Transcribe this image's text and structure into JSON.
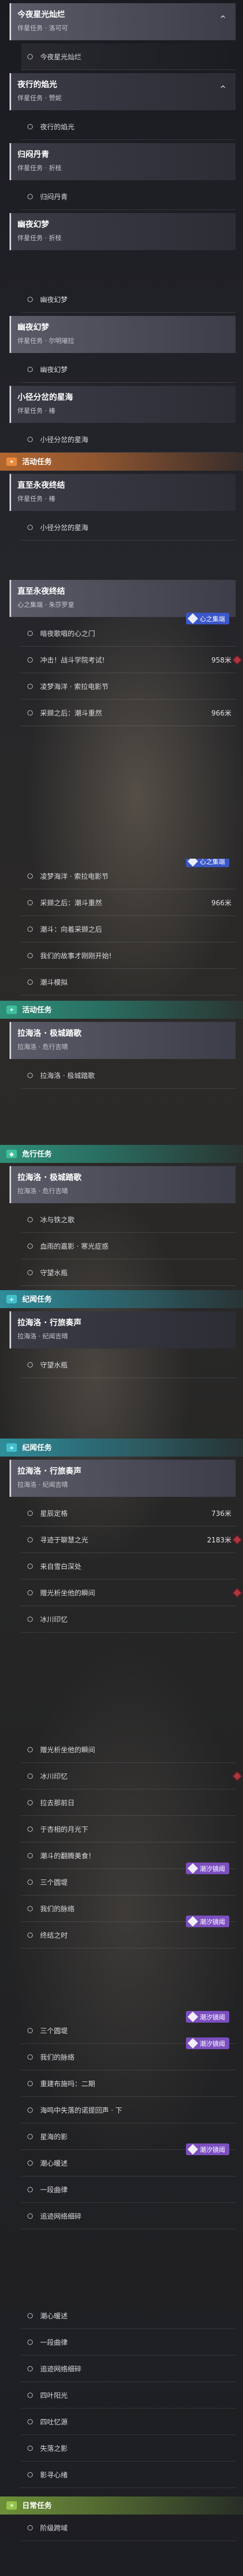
{
  "colors": {
    "orange": "#e98a3c",
    "green": "#3fbf9c",
    "teal": "#43bfcc",
    "lime": "#94c34a",
    "blue_badge": "#3a56c8",
    "purple_badge": "#7c4fc0"
  },
  "seg1": {
    "quests": [
      {
        "title": "今夜星光灿烂",
        "sub": "伴星任务 · 洛可可",
        "chev": "^",
        "row": "今夜星光灿烂"
      },
      {
        "title": "夜行的焰光",
        "sub": "伴星任务 · 赞妮",
        "chev": "^",
        "row": "夜行的焰光"
      },
      {
        "title": "归闷丹青",
        "sub": "伴星任务 · 折枝",
        "chev": "",
        "row": "归闷丹青"
      },
      {
        "title": "幽夜幻梦",
        "sub": "伴星任务 · 折枝",
        "chev": "",
        "row": ""
      }
    ]
  },
  "seg2": {
    "quests": [
      {
        "title": "幽夜幻梦",
        "sub": "伴星任务 · 尔明璀拉",
        "row": "幽夜幻梦"
      },
      {
        "title": "小径分岔的星海",
        "sub": "伴星任务 · 椿",
        "row": "小径分岔的星海"
      }
    ],
    "cat": "活动任务",
    "act": {
      "title": "直至永夜终结",
      "sub": "伴星任务 · 椿",
      "row": "小径分岔的星海"
    }
  },
  "seg3": {
    "quest": {
      "title": "直至永夜终结",
      "sub": "心之集端 · 朱莎罗皇"
    },
    "badge": "心之集端",
    "rows": [
      {
        "text": "暗夜歌唱的心之门",
        "dist": ""
      },
      {
        "text": "冲击！战斗学院考试!",
        "dist": "958米"
      },
      {
        "text": "凌梦海洋 · 索拉电影节",
        "dist": ""
      },
      {
        "text": "采撷之后：潮斗重然",
        "dist": "966米"
      }
    ]
  },
  "seg4": {
    "badge": "心之集端",
    "rows": [
      {
        "text": "凌梦海洋 · 索拉电影节",
        "dist": ""
      },
      {
        "text": "采撷之后：潮斗重然",
        "dist": "966米"
      },
      {
        "text": "潮斗：向着采撷之后",
        "dist": ""
      },
      {
        "text": "我们的故事才刚刚开始!",
        "dist": ""
      },
      {
        "text": "潮斗模拟",
        "dist": ""
      }
    ],
    "cat": "活动任务",
    "quest": {
      "title": "拉海洛 · 极城踏歌",
      "sub": "拉海洛 · 危行吉晴"
    },
    "row": "拉海洛 · 极城踏歌"
  },
  "seg5": {
    "cat": "危行任务",
    "quest": {
      "title": "拉海洛 · 极城踏歌",
      "sub": "拉海洛 · 危行吉晴"
    },
    "rows": [
      "冰与铁之歌",
      "血雨的嘉影 · 寒光症惑",
      "守望水瓶"
    ],
    "cat2": "纪闻任务",
    "quest2": {
      "title": "拉海洛 · 行旅奏声",
      "sub": "拉海洛 · 纪闻吉晴"
    },
    "rows2": [
      "守望水瓶"
    ]
  },
  "seg6": {
    "cat": "纪闻任务",
    "quest": {
      "title": "拉海洛 · 行旅奏声",
      "sub": "拉海洛 · 纪闻吉晴"
    },
    "rows": [
      {
        "text": "星辰定格",
        "dist": "736米"
      },
      {
        "text": "寻迹于聊慧之光",
        "dist": "2183米"
      },
      {
        "text": "来自雪白深处",
        "dist": ""
      },
      {
        "text": "赠光析坐他的瞬间",
        "dist": ""
      },
      {
        "text": "冰川印忆",
        "dist": ""
      }
    ]
  },
  "seg7": {
    "rows": [
      {
        "text": "赠光析坐他的瞬间",
        "badge": ""
      },
      {
        "text": "冰川印忆",
        "badge": ""
      },
      {
        "text": "拉去那前日",
        "badge": ""
      },
      {
        "text": "于杏相的月光下",
        "badge": ""
      },
      {
        "text": "潮斗的翻腾美食！",
        "badge": ""
      },
      {
        "text": "三个圆堤",
        "badge": "潮汐镜阈"
      },
      {
        "text": "我们的脉络",
        "badge": ""
      },
      {
        "text": "终结之时",
        "badge": "潮汐镜阈"
      }
    ]
  },
  "seg8": {
    "rows": [
      {
        "text": "三个圆堤",
        "badge": "潮汐镜阈"
      },
      {
        "text": "我们的脉络",
        "badge": "潮汐镜阈"
      },
      {
        "text": "重建布施吗：二期",
        "badge": ""
      },
      {
        "text": "海鸣中失落的诺提回声 · 下",
        "badge": ""
      },
      {
        "text": "星海的影",
        "badge": ""
      },
      {
        "text": "潮心暖述",
        "badge": "潮汐镜阈"
      },
      {
        "text": "一段曲律",
        "badge": ""
      },
      {
        "text": "追迹网络细碎",
        "badge": ""
      }
    ]
  },
  "seg9": {
    "rows": [
      "潮心暖述",
      "一段曲律",
      "追迹网络细碎",
      "四叶阳光",
      "四吐忆源",
      "失落之影",
      "影寻心绪"
    ],
    "cat": "日常任务",
    "last": "阶级跨域"
  }
}
